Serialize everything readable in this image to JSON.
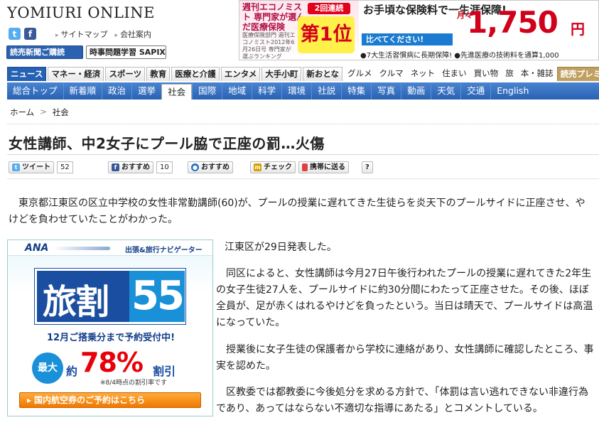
{
  "header": {
    "logo": "YOMIURI ONLINE",
    "links": [
      "サイトマップ",
      "会社案内"
    ],
    "subscribe_button": "読売新聞ご購読",
    "sapix_button": "時事問題学習 SAPIX"
  },
  "banner": {
    "left_text": "週刊エコノミスト 専門家が選んだ医療保険",
    "badge": "2回連続",
    "rank": "第1位",
    "small_text": "医療保険部門 週刊エコノミスト2012年6月26日号 専門家が選ぶランキング",
    "right_text": "お手頃な保険料で一生涯保障!",
    "compare": "比べてください!",
    "month": "月々",
    "price": "1,750",
    "yen": "円",
    "bottom_text": "●7大生活習慣病に長期保障! ●先進医療の技術料を通算1,000"
  },
  "categories": [
    {
      "label": "ニュース",
      "style": "active"
    },
    {
      "label": "マネー・経済",
      "style": "tab"
    },
    {
      "label": "スポーツ",
      "style": "tab"
    },
    {
      "label": "教育",
      "style": "tab"
    },
    {
      "label": "医療と介護",
      "style": "tab"
    },
    {
      "label": "エンタメ",
      "style": "tab"
    },
    {
      "label": "大手小町",
      "style": "tab"
    },
    {
      "label": "新おとな",
      "style": "tab"
    },
    {
      "label": "グルメ",
      "style": "plain"
    },
    {
      "label": "クルマ",
      "style": "plain"
    },
    {
      "label": "ネット",
      "style": "plain"
    },
    {
      "label": "住まい",
      "style": "plain"
    },
    {
      "label": "買い物",
      "style": "plain"
    },
    {
      "label": "旅",
      "style": "plain"
    },
    {
      "label": "本・雑誌",
      "style": "plain"
    },
    {
      "label": "読売プレミアム",
      "style": "premium"
    }
  ],
  "subnav": [
    {
      "label": "総合トップ"
    },
    {
      "label": "新着順"
    },
    {
      "label": "政治"
    },
    {
      "label": "選挙"
    },
    {
      "label": "社会",
      "active": true
    },
    {
      "label": "国際"
    },
    {
      "label": "地域"
    },
    {
      "label": "科学"
    },
    {
      "label": "環境"
    },
    {
      "label": "社説"
    },
    {
      "label": "特集"
    },
    {
      "label": "写真"
    },
    {
      "label": "動画"
    },
    {
      "label": "天気"
    },
    {
      "label": "交通"
    },
    {
      "label": "English"
    }
  ],
  "breadcrumb": {
    "home": "ホーム",
    "separator": ">",
    "section": "社会"
  },
  "article": {
    "title": "女性講師、中2女子にプール脇で正座の罰…火傷",
    "lead": "東京都江東区の区立中学校の女性非常勤講師(60)が、プールの授業に遅れてきた生徒らを炎天下のプールサイドに正座させ、やけどを負わせていたことがわかった。",
    "p1": "江東区が29日発表した。",
    "p2": "同区によると、女性講師は今月27日午後行われたプールの授業に遅れてきた2年生の女子生徒27人を、プールサイドに約30分間にわたって正座させた。その後、ほぼ全員が、足が赤くはれるやけどを負ったという。当日は晴天で、プールサイドは高温になっていた。",
    "p3": "授業後に女子生徒の保護者から学校に連絡があり、女性講師に確認したところ、事実を認めた。",
    "p4": "区教委では都教委に今後処分を求める方針で、「体罰は言い逃れできない非違行為であり、あってはならない不適切な指導にあたる」とコメントしている。"
  },
  "share": {
    "tweet": "ツイート",
    "tweet_count": "52",
    "fb_label": "おすすめ",
    "fb_count": "10",
    "mixi_label": "おすすめ",
    "check_label": "チェック",
    "mobile_label": "携帯に送る",
    "help": "?"
  },
  "ad": {
    "brand": "ANA",
    "navi": "出張&旅行ナビゲーター",
    "logo_text": "旅割",
    "logo_num": "55",
    "deadline": "12月ご搭乗分まで予約受付中!",
    "max": "最大",
    "approx": "約",
    "percent": "78%",
    "discount": "割引",
    "note": "※8/4時点の割引率です",
    "cta": "国内航空券のご予約はこちら"
  },
  "colors": {
    "nav_blue": "#2a62b3",
    "accent_red": "#d0021b"
  }
}
